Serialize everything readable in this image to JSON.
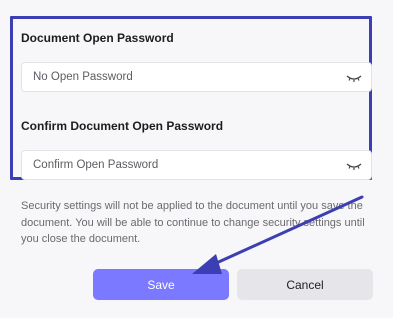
{
  "form": {
    "open_password_label": "Document Open Password",
    "open_password_placeholder": "No Open Password",
    "confirm_password_label": "Confirm Document Open Password",
    "confirm_password_placeholder": "Confirm Open Password"
  },
  "help_text": "Security settings will not be applied to the document until you save the document. You will be able to continue to change security settings until you close the document.",
  "buttons": {
    "save_label": "Save",
    "cancel_label": "Cancel"
  },
  "icons": {
    "password_toggle": "eye-closed-icon"
  },
  "colors": {
    "highlight_border": "#3c3fb3",
    "save_button": "#7b79ff",
    "cancel_button": "#e6e5e9",
    "annotation_arrow": "#3c3fb3"
  }
}
